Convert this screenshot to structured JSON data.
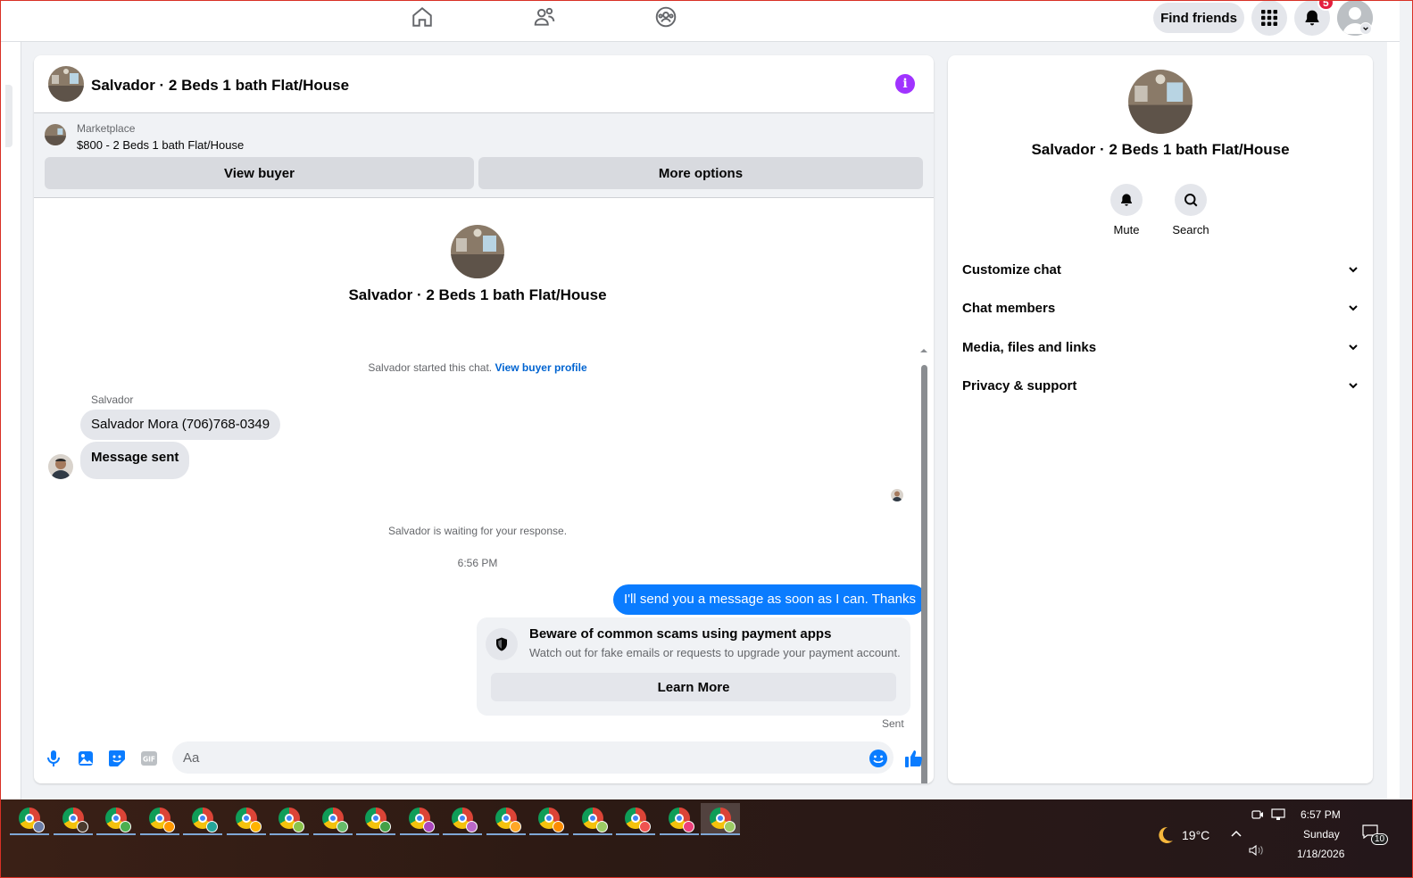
{
  "topbar": {
    "nav": [
      {
        "icon": "home-icon"
      },
      {
        "icon": "friends-icon"
      },
      {
        "icon": "groups-icon"
      }
    ],
    "find_friends": "Find friends",
    "notification_count": "5"
  },
  "conversation": {
    "title": "Salvador · 2 Beds 1 bath Flat/House",
    "marketplace_label": "Marketplace",
    "listing": "$800 - 2 Beds 1 bath Flat/House",
    "view_buyer": "View buyer",
    "more_options": "More options"
  },
  "messages": {
    "header_title": "Salvador · 2 Beds 1 bath Flat/House",
    "started_text": "Salvador started this chat.",
    "view_buyer_profile": "View buyer profile",
    "sender": "Salvador",
    "incoming": [
      "Salvador Mora (706)768-0349",
      "Message sent"
    ],
    "waiting": "Salvador is waiting for your response.",
    "timestamp": "6:56 PM",
    "outgoing": "I'll send you a message as soon as I can. Thanks",
    "scam_title": "Beware of common scams using payment apps",
    "scam_sub": "Watch out for fake emails or requests to upgrade your payment account.",
    "learn_more": "Learn More",
    "status": "Sent"
  },
  "composer": {
    "placeholder": "Aa"
  },
  "info_panel": {
    "title": "Salvador · 2 Beds 1 bath Flat/House",
    "mute": "Mute",
    "search": "Search",
    "sections": [
      "Customize chat",
      "Chat members",
      "Media, files and links",
      "Privacy & support"
    ]
  },
  "taskbar": {
    "temperature": "19°C",
    "time": "6:57 PM",
    "day": "Sunday",
    "date": "1/18/2026",
    "notif_count": "10"
  },
  "colors": {
    "accent": "#0a7cff",
    "link": "#0064d1",
    "info": "#a033ff",
    "badge": "#e41e3f"
  }
}
